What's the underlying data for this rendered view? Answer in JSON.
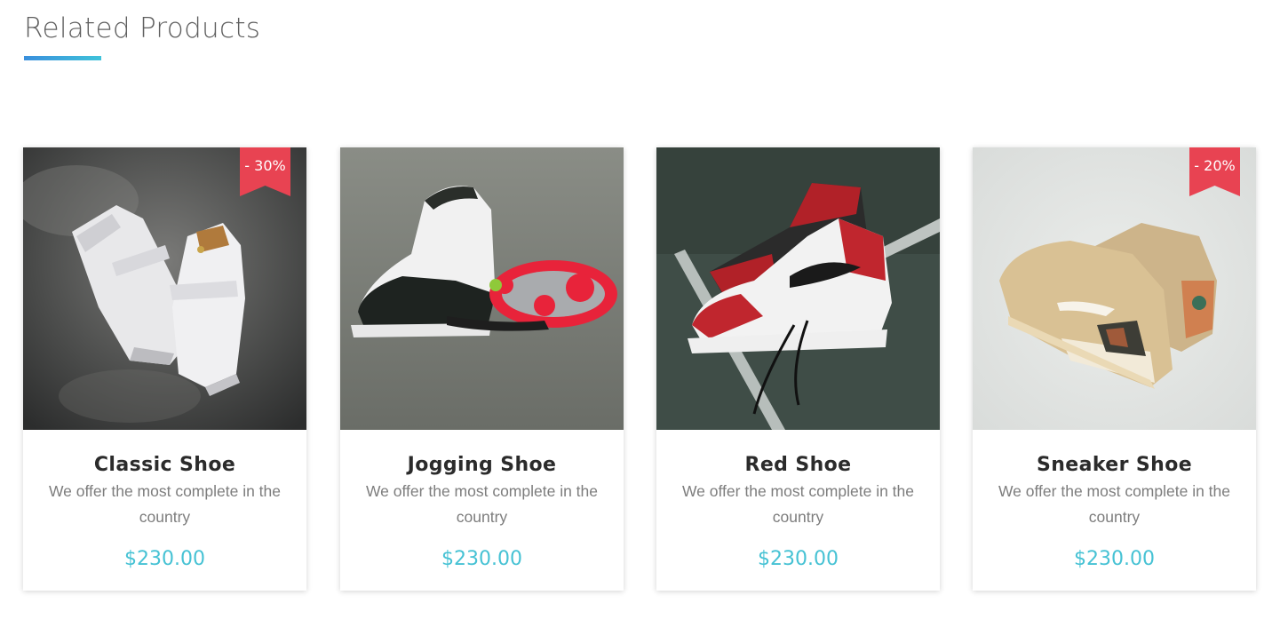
{
  "section": {
    "title": "Related Products",
    "accent_gradient": [
      "#3a8fdc",
      "#3fc2da"
    ]
  },
  "colors": {
    "ribbon": "#e84352",
    "price": "#46c2d4"
  },
  "products": [
    {
      "name": "Classic Shoe",
      "description": "We offer the most complete in the country",
      "price": "$230.00",
      "discount": "- 30%",
      "image": "white-high-top-sneakers-photo"
    },
    {
      "name": "Jogging Shoe",
      "description": "We offer the most complete in the country",
      "price": "$230.00",
      "discount": null,
      "image": "black-white-basketball-sneakers-photo"
    },
    {
      "name": "Red Shoe",
      "description": "We offer the most complete in the country",
      "price": "$230.00",
      "discount": null,
      "image": "red-black-high-top-sneakers-photo"
    },
    {
      "name": "Sneaker Shoe",
      "description": "We offer the most complete in the country",
      "price": "$230.00",
      "discount": "- 20%",
      "image": "beige-running-sneakers-photo"
    }
  ]
}
